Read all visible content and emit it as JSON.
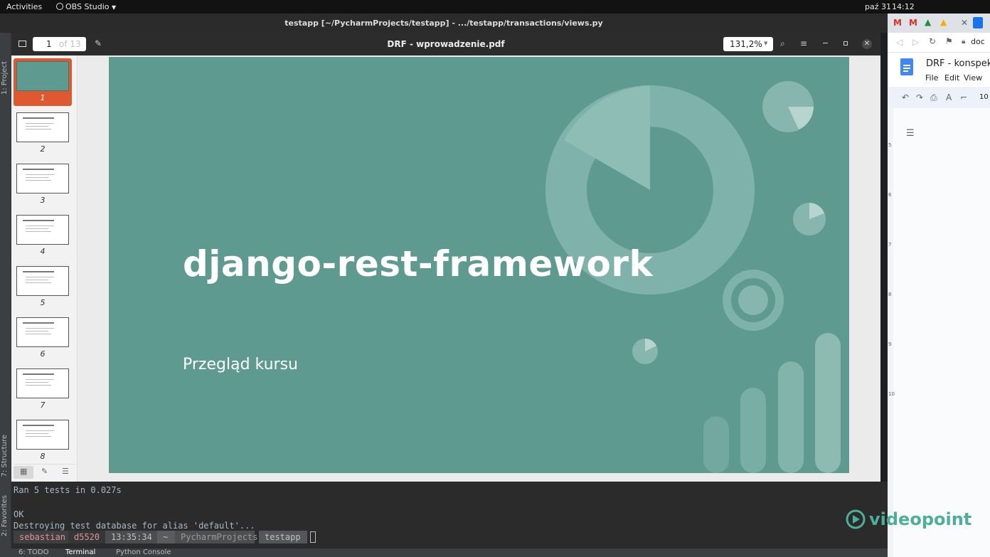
{
  "topbar": {
    "activities": "Activities",
    "app_name": "OBS Studio",
    "date": "paź 31",
    "time": "14:12"
  },
  "pycharm": {
    "window_title": "testapp [~/PycharmProjects/testapp] - .../testapp/transactions/views.py",
    "left_tools": {
      "project": "1: Project",
      "structure": "7: Structure",
      "favorites": "2: Favorites"
    },
    "bottom_tabs": [
      "6: TODO",
      "Terminal",
      "Python Console"
    ]
  },
  "pdf_viewer": {
    "page_current": "1",
    "page_of": "of 13",
    "document_title": "DRF - wprowadzenie.pdf",
    "zoom": "131,2%",
    "thumbnails": [
      "1",
      "2",
      "3",
      "4",
      "5",
      "6",
      "7",
      "8"
    ],
    "selected_thumbnail": 1
  },
  "slide": {
    "title": "django-rest-framework",
    "subtitle": "Przegląd kursu",
    "bg_color": "#5f9a91"
  },
  "terminal": {
    "lines": [
      "Ran 5 tests in 0.027s",
      "",
      "OK",
      "Destroying test database for alias 'default'..."
    ],
    "prompt": {
      "user": "sebastian",
      "host": "d5520",
      "time": "13:35:34",
      "home": "~",
      "dir1": "PycharmProjects",
      "dir2": "testapp"
    }
  },
  "chrome": {
    "url_fragment": "doc",
    "doc_title": "DRF - konspekt",
    "menu": [
      "File",
      "Edit",
      "View"
    ],
    "font_size": "10",
    "ruler_numbers": [
      "5",
      "6",
      "7",
      "8",
      "9",
      "10"
    ]
  },
  "watermark": {
    "brand": "videopoint",
    "brand_color": "#4fae9b"
  },
  "colors": {
    "accent_selected": "#e0582f",
    "terminal_bg": "#2b2b2b"
  }
}
